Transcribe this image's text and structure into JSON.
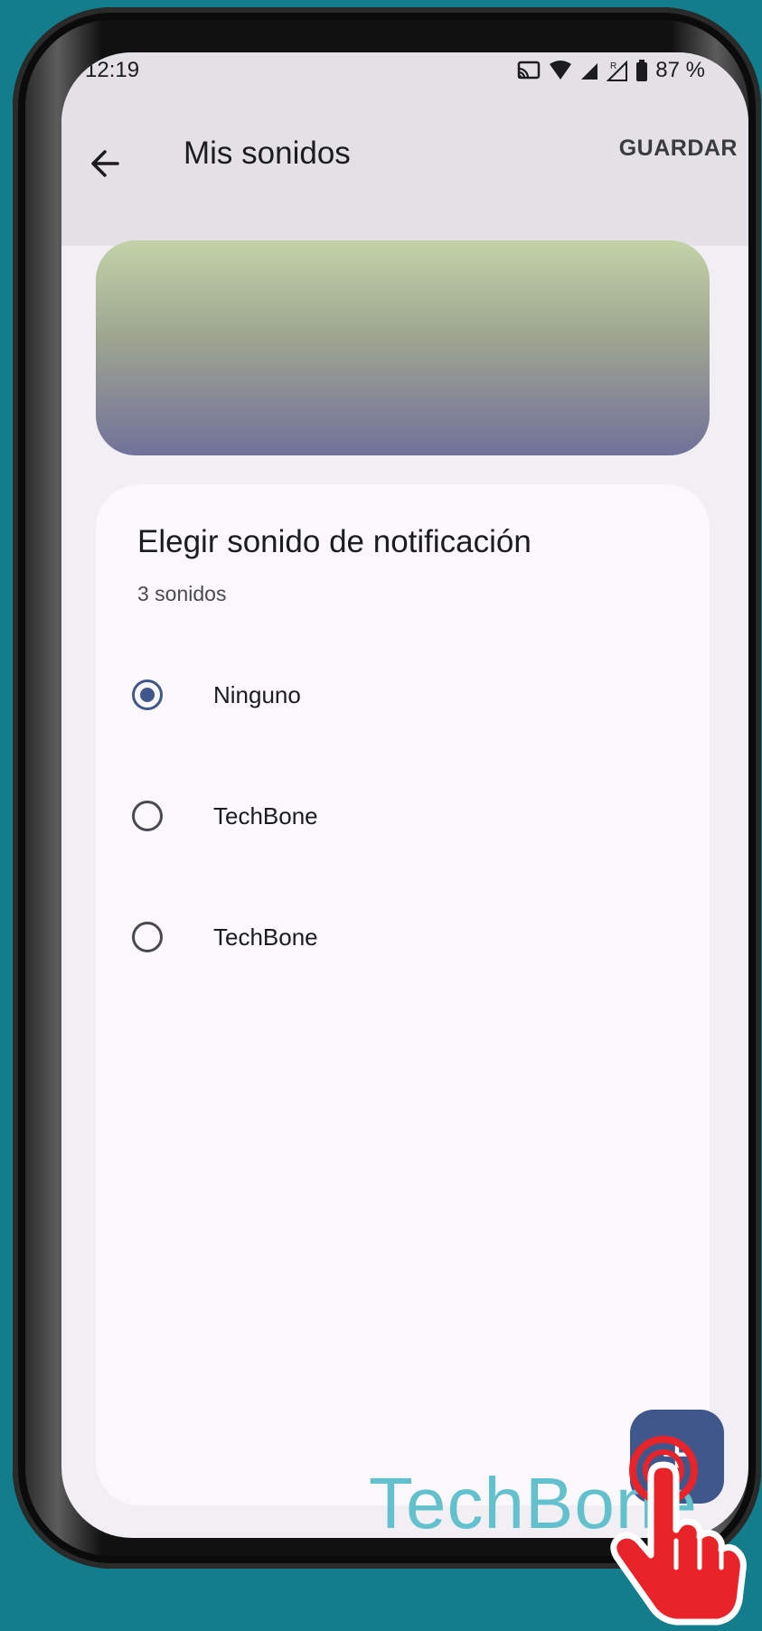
{
  "status_bar": {
    "time": "12:19",
    "battery_percent": "87 %",
    "icons": [
      "cast-icon",
      "wifi-icon",
      "signal-icon",
      "signal-roaming-icon",
      "battery-icon"
    ]
  },
  "app_bar": {
    "back_icon": "arrow-left-icon",
    "title": "Mis sonidos",
    "save_label": "GUARDAR"
  },
  "sound_picker": {
    "title": "Elegir sonido de notificación",
    "count_label": "3 sonidos",
    "options": [
      {
        "label": "Ninguno",
        "selected": true
      },
      {
        "label": "TechBone",
        "selected": false
      },
      {
        "label": "TechBone",
        "selected": false
      }
    ]
  },
  "fab": {
    "icon": "plus-icon",
    "label": "+"
  },
  "watermark": "TechBone",
  "colors": {
    "background": "#137d8b",
    "accent": "#40578c",
    "app_bar": "#e3e1e6",
    "card": "#faf8fb",
    "watermark": "#63c1cd",
    "tap_indicator": "#e8242a"
  }
}
